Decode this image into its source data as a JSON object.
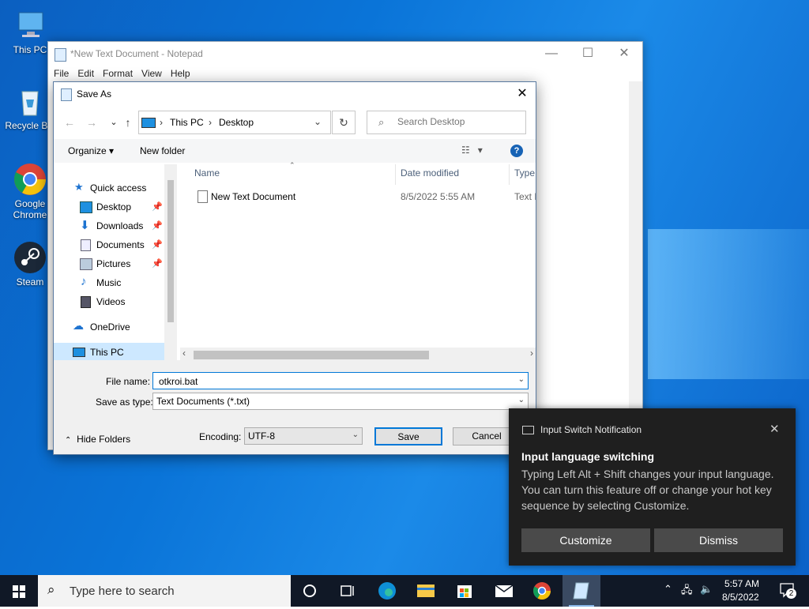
{
  "desktop": {
    "icons": [
      {
        "label": "This PC"
      },
      {
        "label": "Recycle Bin"
      },
      {
        "label": "Google Chrome"
      },
      {
        "label": "Steam"
      }
    ]
  },
  "notepad": {
    "title": "*New Text Document - Notepad",
    "menu": [
      "File",
      "Edit",
      "Format",
      "View",
      "Help"
    ]
  },
  "dialog": {
    "title": "Save As",
    "breadcrumb": [
      "This PC",
      "Desktop"
    ],
    "search_placeholder": "Search Desktop",
    "toolbar": {
      "organize": "Organize",
      "new_folder": "New folder",
      "help": "?"
    },
    "nav_items": [
      {
        "label": "Quick access"
      },
      {
        "label": "Desktop"
      },
      {
        "label": "Downloads"
      },
      {
        "label": "Documents"
      },
      {
        "label": "Pictures"
      },
      {
        "label": "Music"
      },
      {
        "label": "Videos"
      },
      {
        "label": "OneDrive"
      },
      {
        "label": "This PC"
      }
    ],
    "columns": {
      "name": "Name",
      "date": "Date modified",
      "type": "Type"
    },
    "files": [
      {
        "name": "New Text Document",
        "date": "8/5/2022 5:55 AM",
        "type": "Text Document"
      }
    ],
    "file_name_label": "File name:",
    "file_name_value": "otkroi.bat",
    "save_type_label": "Save as type:",
    "save_type_value": "Text Documents (*.txt)",
    "hide_folders": "Hide Folders",
    "encoding_label": "Encoding:",
    "encoding_value": "UTF-8",
    "save": "Save",
    "cancel": "Cancel"
  },
  "notification": {
    "header": "Input Switch Notification",
    "title": "Input language switching",
    "body": "Typing Left Alt + Shift changes your input language. You can turn this feature off or change your hot key sequence by selecting Customize.",
    "customize": "Customize",
    "dismiss": "Dismiss"
  },
  "taskbar": {
    "search_placeholder": "Type here to search",
    "time": "5:57 AM",
    "date": "8/5/2022",
    "notification_count": "2"
  },
  "colors": {
    "accent": "#0078d7",
    "taskbar": "#101826",
    "toast": "#1f1f1f"
  }
}
